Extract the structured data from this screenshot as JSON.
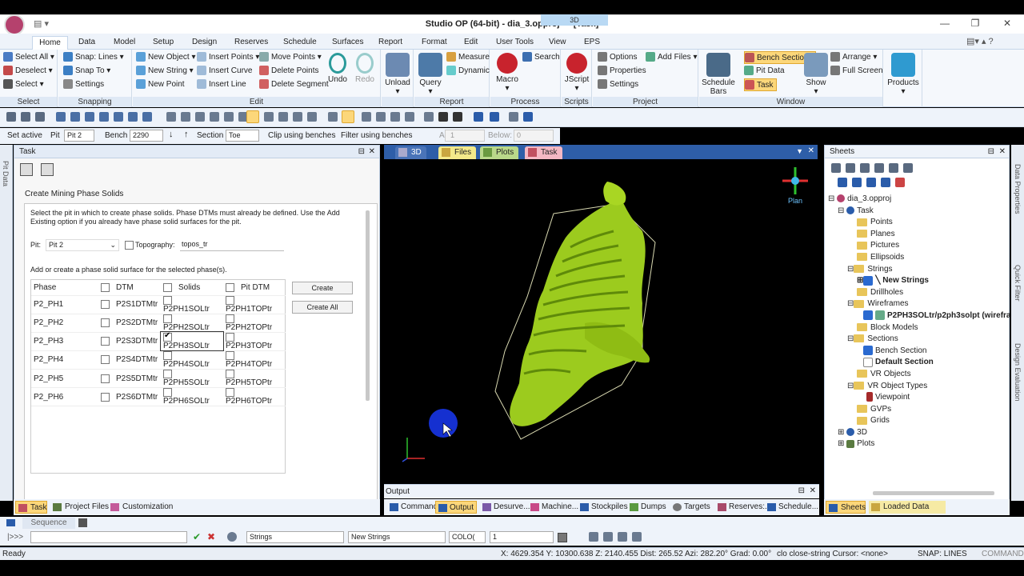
{
  "title": "Studio OP (64-bit) - dia_3.opproj * - [Task]",
  "context_tab": "3D",
  "ribbon_tabs": [
    "Home",
    "Data",
    "Model",
    "Setup",
    "Design",
    "Reserves",
    "Schedule",
    "Surfaces",
    "Report",
    "Format",
    "Edit",
    "User Tools",
    "View",
    "EPS"
  ],
  "ribbon": {
    "select": {
      "items": [
        "Select All",
        "Deselect",
        "Select"
      ],
      "label": "Select"
    },
    "snapping": {
      "items": [
        "Snap: Lines",
        "Snap To",
        "Settings"
      ],
      "label": "Snapping"
    },
    "edit": {
      "items": [
        "New Object",
        "New String",
        "New Point",
        "Insert Points",
        "Insert Curve",
        "Insert Line",
        "Move Points",
        "Delete Points",
        "Delete Segment"
      ],
      "undo": "Undo",
      "redo": "Redo",
      "label": "Edit"
    },
    "unload": "Unload",
    "query": "Query",
    "measure": "Measure",
    "dynamic": "Dynamic",
    "report_label": "Report",
    "macro": "Macro",
    "search": "Search",
    "process_label": "Process",
    "jscript": "JScript",
    "scripts_label": "Scripts",
    "project": {
      "items": [
        "Options",
        "Properties",
        "Settings",
        "Add Files"
      ],
      "label": "Project"
    },
    "window": {
      "schedule_bars": "Schedule Bars",
      "bench_sections": "Bench Sections",
      "pit_data": "Pit Data",
      "task": "Task",
      "show": "Show",
      "arrange": "Arrange",
      "full_screen": "Full Screen",
      "label": "Window"
    },
    "products": "Products"
  },
  "toolbar2": {
    "set_active": "Set active",
    "pit_label": "Pit",
    "pit_value": "Pit 2",
    "bench_label": "Bench",
    "bench_value": "2290",
    "section_label": "Section",
    "section_value": "Toe",
    "clip": "Clip using benches",
    "filter": "Filter using benches",
    "above_label": "Above:",
    "above_value": "1",
    "below_label": "Below:",
    "below_value": "0"
  },
  "left_strip": "Pit Data",
  "task_panel": {
    "title": "Task",
    "heading": "Create Mining Phase Solids",
    "desc": "Select the pit in which to create phase solids. Phase DTMs must already be defined. Use the Add Existing option if you already have phase solid surfaces for the pit.",
    "pit_label": "Pit:",
    "pit_value": "Pit 2",
    "topo_label": "Topography:",
    "topo_value": "topos_tr",
    "add_text": "Add or create a phase solid surface for the selected phase(s).",
    "columns": [
      "Phase",
      "DTM",
      "Solids",
      "Pit DTM"
    ],
    "rows": [
      {
        "phase": "P2_PH1",
        "dtm": "P2S1DTMtr",
        "solids": "P2PH1SOLtr",
        "pit": "P2PH1TOPtr",
        "checked": false
      },
      {
        "phase": "P2_PH2",
        "dtm": "P2S2DTMtr",
        "solids": "P2PH2SOLtr",
        "pit": "P2PH2TOPtr",
        "checked": false
      },
      {
        "phase": "P2_PH3",
        "dtm": "P2S3DTMtr",
        "solids": "P2PH3SOLtr",
        "pit": "P2PH3TOPtr",
        "checked": true
      },
      {
        "phase": "P2_PH4",
        "dtm": "P2S4DTMtr",
        "solids": "P2PH4SOLtr",
        "pit": "P2PH4TOPtr",
        "checked": false
      },
      {
        "phase": "P2_PH5",
        "dtm": "P2S5DTMtr",
        "solids": "P2PH5SOLtr",
        "pit": "P2PH5TOPtr",
        "checked": false
      },
      {
        "phase": "P2_PH6",
        "dtm": "P2S6DTMtr",
        "solids": "P2PH6SOLtr",
        "pit": "P2PH6TOPtr",
        "checked": false
      }
    ],
    "create": "Create",
    "create_all": "Create All"
  },
  "view_tabs": [
    "3D",
    "Files",
    "Plots",
    "Task"
  ],
  "plan_label": "Plan",
  "output": {
    "title": "Output",
    "tabs": [
      "Command",
      "Output",
      "Desurve...",
      "Machine...",
      "Stockpiles",
      "Dumps",
      "Targets",
      "Reserves:...",
      "Schedule..."
    ]
  },
  "bottom_tabs": [
    "Task",
    "Project Files",
    "Customization"
  ],
  "sheets": {
    "title": "Sheets",
    "tree": [
      {
        "label": "dia_3.opproj",
        "level": 0,
        "bold": false
      },
      {
        "label": "Task",
        "level": 1,
        "bold": false
      },
      {
        "label": "Points",
        "level": 2,
        "bold": false
      },
      {
        "label": "Planes",
        "level": 2,
        "bold": false
      },
      {
        "label": "Pictures",
        "level": 2,
        "bold": false
      },
      {
        "label": "Ellipsoids",
        "level": 2,
        "bold": false
      },
      {
        "label": "Strings",
        "level": 2,
        "bold": false
      },
      {
        "label": "New Strings",
        "level": 3,
        "bold": true
      },
      {
        "label": "Drillholes",
        "level": 2,
        "bold": false
      },
      {
        "label": "Wireframes",
        "level": 2,
        "bold": false
      },
      {
        "label": "P2PH3SOLtr/p2ph3solpt (wirefra",
        "level": 3,
        "bold": true
      },
      {
        "label": "Block Models",
        "level": 2,
        "bold": false
      },
      {
        "label": "Sections",
        "level": 2,
        "bold": false
      },
      {
        "label": "Bench Section",
        "level": 3,
        "bold": false
      },
      {
        "label": "Default Section",
        "level": 3,
        "bold": true
      },
      {
        "label": "VR Objects",
        "level": 2,
        "bold": false
      },
      {
        "label": "VR Object Types",
        "level": 2,
        "bold": false
      },
      {
        "label": "Viewpoint",
        "level": 3,
        "bold": false
      },
      {
        "label": "GVPs",
        "level": 2,
        "bold": false
      },
      {
        "label": "Grids",
        "level": 2,
        "bold": false
      },
      {
        "label": "3D",
        "level": 1,
        "bold": false
      },
      {
        "label": "Plots",
        "level": 1,
        "bold": false
      }
    ],
    "tabs": [
      "Sheets",
      "Loaded Data"
    ]
  },
  "right_strip": [
    "Data Properties",
    "Quick Filter",
    "Design Evaluation"
  ],
  "sequence": "Sequence",
  "cmdbar": {
    "prompt": "|>>>",
    "layer": "Strings",
    "object": "New Strings",
    "color": "COLO(",
    "width": "1"
  },
  "status": {
    "ready": "Ready",
    "coords": "X: 4629.354  Y: 10300.638  Z: 2140.455  Dist: 265.52  Azi: 282.20°  Grad: 0.00°",
    "cmd": "clo close-string  Cursor: <none>",
    "snap": "SNAP: LINES",
    "mode": "COMMAND"
  }
}
